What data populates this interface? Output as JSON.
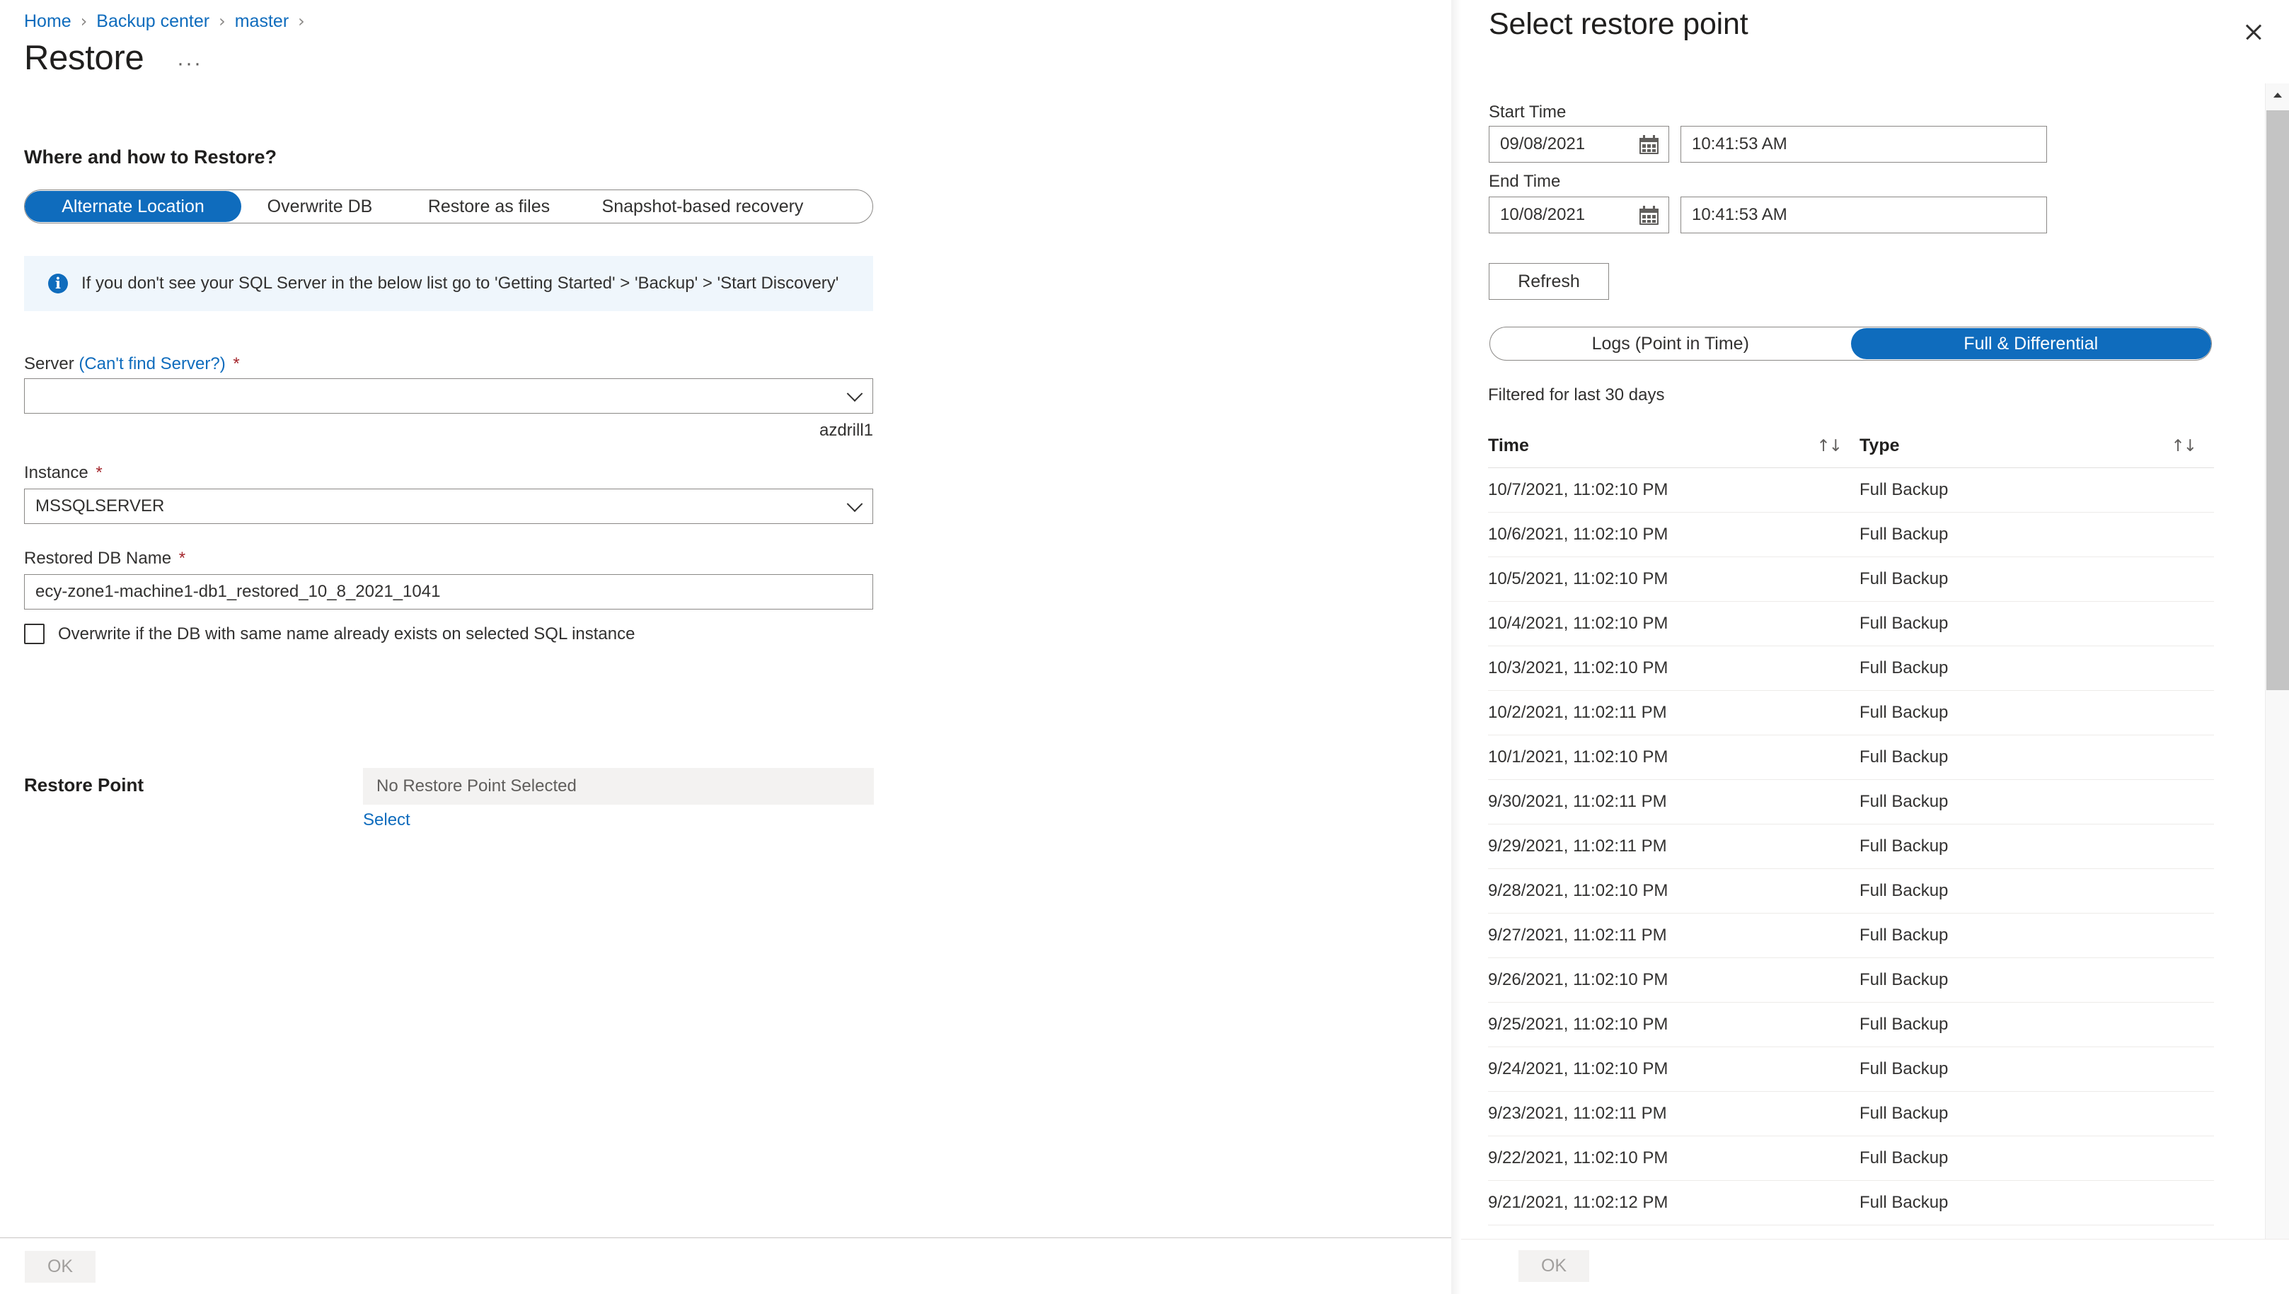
{
  "breadcrumb": {
    "items": [
      "Home",
      "Backup center",
      "master"
    ],
    "separator": "›"
  },
  "page": {
    "title": "Restore",
    "ellipsis": "···",
    "section_heading": "Where and how to Restore?"
  },
  "pivot": {
    "items": [
      {
        "label": "Alternate Location",
        "selected": true
      },
      {
        "label": "Overwrite DB",
        "selected": false
      },
      {
        "label": "Restore as files",
        "selected": false
      },
      {
        "label": "Snapshot-based recovery",
        "selected": false
      }
    ]
  },
  "info_banner": {
    "icon": "info-icon",
    "glyph": "i",
    "text": "If you don't see your SQL Server in the below list go to 'Getting Started' > 'Backup' > 'Start Discovery'"
  },
  "form": {
    "server": {
      "label": "Server",
      "link": "(Can't find Server?)",
      "required": "*",
      "value": "",
      "placeholder": "",
      "helper": "azdrill1"
    },
    "instance": {
      "label": "Instance",
      "required": "*",
      "value": "MSSQLSERVER"
    },
    "restored_db_name": {
      "label": "Restored DB Name",
      "required": "*",
      "value": "ecy-zone1-machine1-db1_restored_10_8_2021_1041"
    },
    "overwrite_checkbox": {
      "label": "Overwrite if the DB with same name already exists on selected SQL instance",
      "checked": false
    },
    "restore_point": {
      "label": "Restore Point",
      "value": "No Restore Point Selected",
      "select_link": "Select"
    }
  },
  "footer": {
    "ok_label": "OK"
  },
  "panel": {
    "title": "Select restore point",
    "close_icon": "close-icon",
    "start_time": {
      "label": "Start Time",
      "date": "09/08/2021",
      "time": "10:41:53 AM"
    },
    "end_time": {
      "label": "End Time",
      "date": "10/08/2021",
      "time": "10:41:53 AM"
    },
    "refresh_label": "Refresh",
    "pivot": [
      {
        "label": "Logs (Point in Time)",
        "selected": false
      },
      {
        "label": "Full & Differential",
        "selected": true
      }
    ],
    "filter_note": "Filtered for last 30 days",
    "table": {
      "columns": [
        "Time",
        "Type"
      ],
      "sort_icon": "↑↓",
      "rows": [
        {
          "time": "10/7/2021, 11:02:10 PM",
          "type": "Full Backup"
        },
        {
          "time": "10/6/2021, 11:02:10 PM",
          "type": "Full Backup"
        },
        {
          "time": "10/5/2021, 11:02:10 PM",
          "type": "Full Backup"
        },
        {
          "time": "10/4/2021, 11:02:10 PM",
          "type": "Full Backup"
        },
        {
          "time": "10/3/2021, 11:02:10 PM",
          "type": "Full Backup"
        },
        {
          "time": "10/2/2021, 11:02:11 PM",
          "type": "Full Backup"
        },
        {
          "time": "10/1/2021, 11:02:10 PM",
          "type": "Full Backup"
        },
        {
          "time": "9/30/2021, 11:02:11 PM",
          "type": "Full Backup"
        },
        {
          "time": "9/29/2021, 11:02:11 PM",
          "type": "Full Backup"
        },
        {
          "time": "9/28/2021, 11:02:10 PM",
          "type": "Full Backup"
        },
        {
          "time": "9/27/2021, 11:02:11 PM",
          "type": "Full Backup"
        },
        {
          "time": "9/26/2021, 11:02:10 PM",
          "type": "Full Backup"
        },
        {
          "time": "9/25/2021, 11:02:10 PM",
          "type": "Full Backup"
        },
        {
          "time": "9/24/2021, 11:02:10 PM",
          "type": "Full Backup"
        },
        {
          "time": "9/23/2021, 11:02:11 PM",
          "type": "Full Backup"
        },
        {
          "time": "9/22/2021, 11:02:10 PM",
          "type": "Full Backup"
        },
        {
          "time": "9/21/2021, 11:02:12 PM",
          "type": "Full Backup"
        }
      ]
    },
    "ok_label": "OK"
  },
  "colors": {
    "accent": "#0f6cbd",
    "link": "#0f6cbd",
    "required": "#a4262c",
    "info_bg": "#eff6fc",
    "disabled_bg": "#f3f2f1",
    "disabled_text": "#a19f9d"
  }
}
